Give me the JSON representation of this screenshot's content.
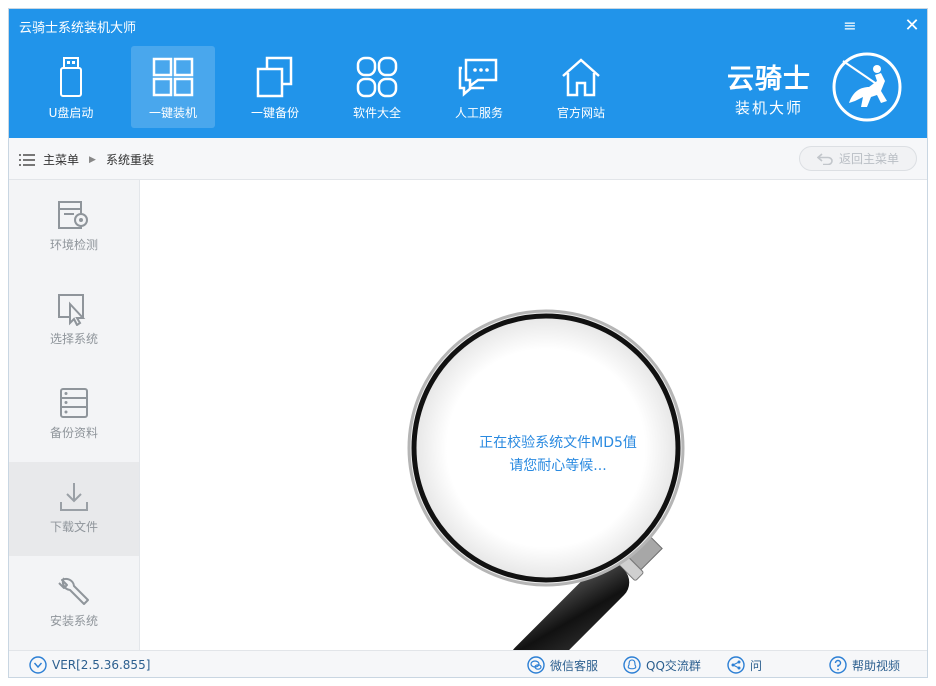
{
  "app": {
    "title": "云骑士系统装机大师"
  },
  "window": {
    "menu_icon": "≡",
    "close_icon": "✕"
  },
  "nav": [
    {
      "label": "U盘启动",
      "icon": "usb-icon"
    },
    {
      "label": "一键装机",
      "icon": "windows-icon",
      "active": true
    },
    {
      "label": "一键备份",
      "icon": "backup-icon"
    },
    {
      "label": "软件大全",
      "icon": "apps-icon"
    },
    {
      "label": "人工服务",
      "icon": "chat-icon"
    },
    {
      "label": "官方网站",
      "icon": "home-icon"
    }
  ],
  "logo": {
    "line1": "云骑士",
    "line2": "装机大师"
  },
  "breadcrumb": {
    "root": "主菜单",
    "current": "系统重装"
  },
  "back_button": {
    "label": "返回主菜单"
  },
  "sidebar": [
    {
      "label": "环境检测",
      "icon": "environment-check-icon"
    },
    {
      "label": "选择系统",
      "icon": "cursor-select-icon"
    },
    {
      "label": "备份资料",
      "icon": "database-icon"
    },
    {
      "label": "下载文件",
      "icon": "download-icon",
      "active": true
    },
    {
      "label": "安装系统",
      "icon": "wrench-icon"
    }
  ],
  "main": {
    "status_line1": "正在校验系统文件MD5值",
    "status_line2": "请您耐心等候..."
  },
  "footer": {
    "version": "VER[2.5.36.855]",
    "wechat": "微信客服",
    "qq": "QQ交流群",
    "share": "问",
    "help": "帮助视频"
  },
  "colors": {
    "header": "#2194ea",
    "status_text": "#2a8ae0",
    "footer_text": "#2c5f8f"
  }
}
